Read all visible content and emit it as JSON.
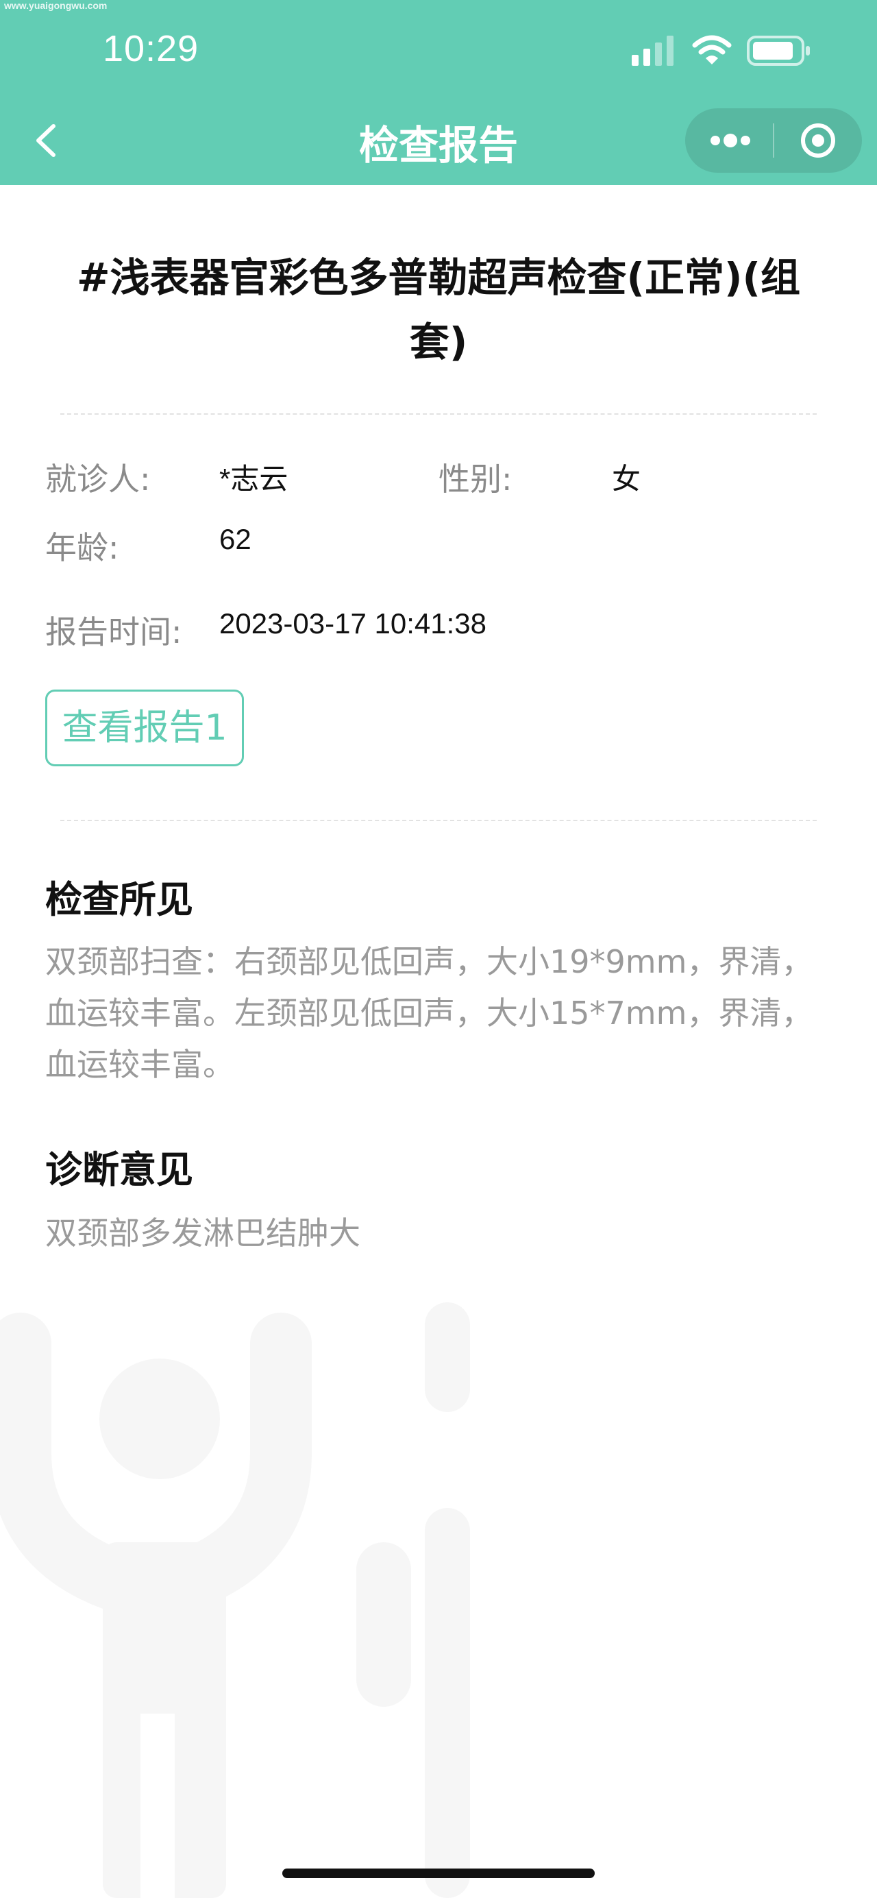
{
  "watermark": "www.yuaigongwu.com",
  "status_bar": {
    "time": "10:29"
  },
  "nav": {
    "title": "检查报告"
  },
  "report": {
    "title": "#浅表器官彩色多普勒超声检查(正常)(组套)",
    "patient_label": "就诊人:",
    "patient_value": "*志云",
    "gender_label": "性别:",
    "gender_value": "女",
    "age_label": "年龄:",
    "age_value": "62",
    "time_label": "报告时间:",
    "time_value": "2023-03-17 10:41:38",
    "view_button": "查看报告1"
  },
  "findings": {
    "title": "检查所见",
    "text": "双颈部扫查：右颈部见低回声，大小19*9mm，界清，血运较丰富。左颈部见低回声，大小15*7mm，界清，血运较丰富。"
  },
  "diagnosis": {
    "title": "诊断意见",
    "text": "双颈部多发淋巴结肿大"
  },
  "colors": {
    "header": "#62cdb4",
    "accent": "#62cdb4",
    "label": "#8a8a8a",
    "body_text": "#9a9a9a"
  },
  "icons": [
    "signal-icon",
    "wifi-icon",
    "battery-icon",
    "back-arrow-icon",
    "more-icon",
    "close-target-icon"
  ]
}
